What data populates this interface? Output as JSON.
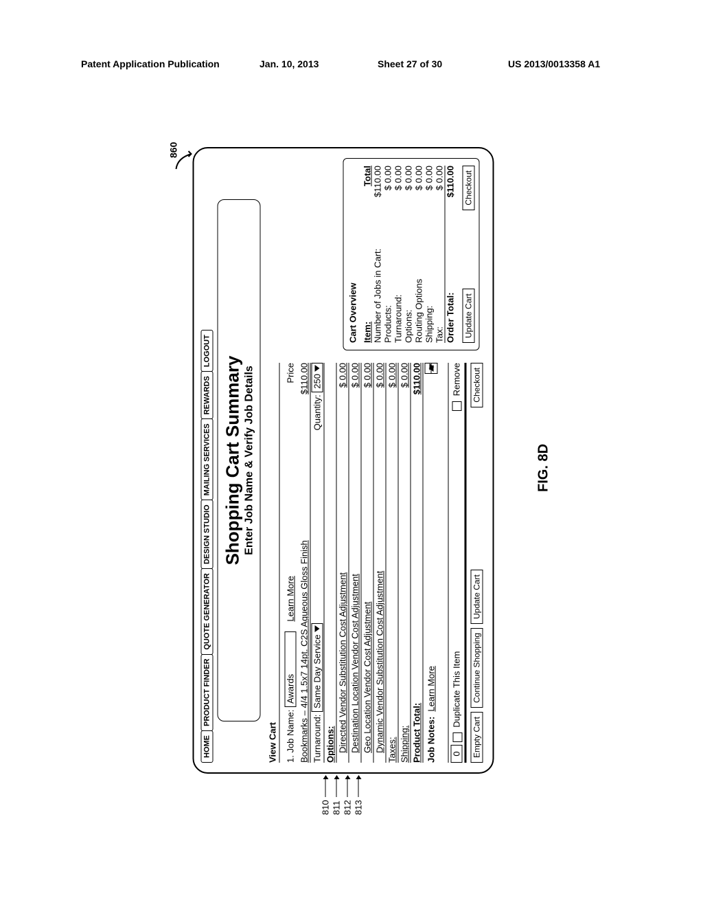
{
  "header": {
    "pubtype": "Patent Application Publication",
    "date": "Jan. 10, 2013",
    "sheet": "Sheet 27 of 30",
    "pubnum": "US 2013/0013358 A1"
  },
  "figure_label": "FIG. 8D",
  "ref_number": "860",
  "callouts": [
    "810",
    "811",
    "812",
    "813"
  ],
  "nav": [
    "HOME",
    "PRODUCT FINDER",
    "QUOTE GENERATOR",
    "DESIGN STUDIO",
    "MAILING SERVICES",
    "REWARDS",
    "LOGOUT"
  ],
  "title": "Shopping Cart Summary",
  "subtitle": "Enter Job Name & Verify Job Details",
  "viewcart": "View Cart",
  "job": {
    "label": "1. Job Name:",
    "name": "Awards",
    "learn_more": "Learn More",
    "price_hdr": "Price",
    "bookmarks_line": "Bookmarks – 4/4 1.5x7 14pt. C2S Aqueous Gloss Finish",
    "bookmarks_price": "$110.00",
    "turnaround_label": "Turnaround:",
    "turnaround_value": "Same Day Service",
    "qty_label": "Quantity:",
    "qty_value": "250"
  },
  "options_hdr": "Options:",
  "options": [
    {
      "label": "Directed Vendor Substitution Cost Adjustment",
      "price": "$ 0.00"
    },
    {
      "label": "Destination Location Vendor Cost Adjustment",
      "price": "$ 0.00"
    },
    {
      "label": "Geo Location Vendor Cost Adjustment",
      "price": "$ 0.00"
    },
    {
      "label": "Dynamic Vendor Substitution Cost Adjustment",
      "price": "$ 0.00"
    }
  ],
  "taxes": {
    "label": "Taxes:",
    "price": "$ 0.00"
  },
  "shipping": {
    "label": "Shipping:",
    "price": "$ 0.00"
  },
  "product_total": {
    "label": "Product Total:",
    "price": "$110.00"
  },
  "job_notes_label": "Job Notes:",
  "job_notes_learn": "Learn More",
  "dup_count": "0",
  "dup_label": "Duplicate This Item",
  "remove_label": "Remove",
  "bottom_buttons": {
    "empty": "Empty Cart",
    "continue": "Continue Shopping",
    "update": "Update Cart",
    "checkout": "Checkout"
  },
  "overview": {
    "title": "Cart Overview",
    "item_hdr": "Item:",
    "total_hdr": "Total",
    "rows": [
      {
        "label": "Number of Jobs in Cart:",
        "value": "$110.00"
      },
      {
        "label": "Products:",
        "value": "$ 0.00"
      },
      {
        "label": "Turnaround:",
        "value": "$ 0.00"
      },
      {
        "label": "Options:",
        "value": "$ 0.00"
      },
      {
        "label": "Routing Options",
        "value": "$ 0.00"
      },
      {
        "label": "Shipping:",
        "value": "$ 0.00"
      },
      {
        "label": "Tax:",
        "value": "$ 0.00"
      }
    ],
    "order_total_label": "Order Total:",
    "order_total_value": "$110.00",
    "update": "Update Cart",
    "checkout": "Checkout"
  }
}
